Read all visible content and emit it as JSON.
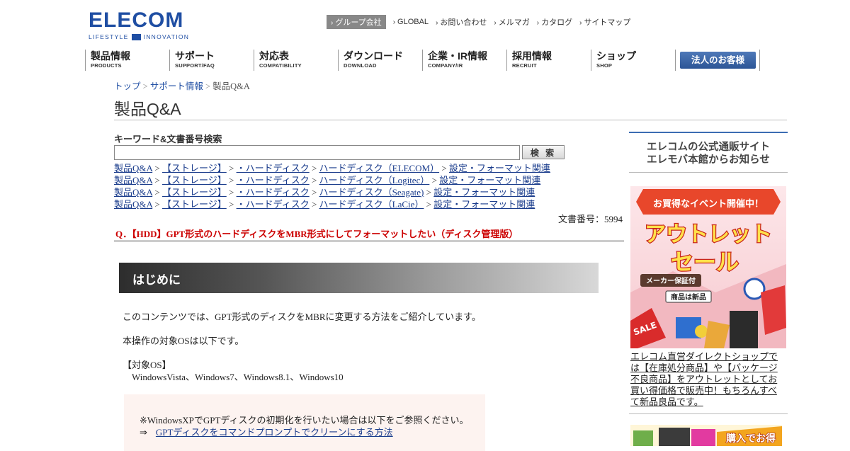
{
  "header": {
    "logo_main": "ELECOM",
    "logo_sub_left": "LIFESTYLE",
    "logo_sub_right": "INNOVATION",
    "util_nav": [
      "グループ会社",
      "GLOBAL",
      "お問い合わせ",
      "メルマガ",
      "カタログ",
      "サイトマップ"
    ],
    "main_nav": [
      {
        "jp": "製品情報",
        "en": "PRODUCTS"
      },
      {
        "jp": "サポート",
        "en": "SUPPORT/FAQ"
      },
      {
        "jp": "対応表",
        "en": "COMPATIBILITY"
      },
      {
        "jp": "ダウンロード",
        "en": "DOWNLOAD"
      },
      {
        "jp": "企業・IR情報",
        "en": "COMPANY/IR"
      },
      {
        "jp": "採用情報",
        "en": "RECRUIT"
      },
      {
        "jp": "ショップ",
        "en": "SHOP"
      }
    ],
    "corporate_button": "法人のお客様"
  },
  "breadcrumb": {
    "top": "トップ",
    "support": "サポート情報",
    "current": "製品Q&A",
    "sep": ">"
  },
  "page_title": "製品Q&A",
  "search": {
    "label": "キーワード&文書番号検索",
    "value": "",
    "button": "検 索"
  },
  "category_paths": [
    [
      "製品Q&A",
      "【ストレージ】",
      "・ハードディスク",
      "ハードディスク（ELECOM）",
      "設定・フォーマット関連"
    ],
    [
      "製品Q&A",
      "【ストレージ】",
      "・ハードディスク",
      "ハードディスク（Logitec）",
      "設定・フォーマット関連"
    ],
    [
      "製品Q&A",
      "【ストレージ】",
      "・ハードディスク",
      "ハードディスク（Seagate)",
      "設定・フォーマット関連"
    ],
    [
      "製品Q&A",
      "【ストレージ】",
      "・ハードディスク",
      "ハードディスク（LaCie）",
      "設定・フォーマット関連"
    ]
  ],
  "doc_number": "文書番号：5994",
  "question": "Q．【HDD】GPT形式のハードディスクをMBR形式にしてフォーマットしたい（ディスク管理版）",
  "article": {
    "intro_heading": "はじめに",
    "p1": "このコンテンツでは、GPT形式のディスクをMBRに変更する方法をご紹介しています。",
    "p2": "本操作の対象OSは以下です。",
    "p3": "【対象OS】",
    "p4": "WindowsVista、Windows7、Windows8.1、Windows10",
    "note": "※WindowsXPでGPTディスクの初期化を行いたい場合は以下をご参照ください。",
    "note_arrow": "⇒",
    "note_link": "GPTディスクをコマンドプロンプトでクリーンにする方法"
  },
  "sidebar": {
    "box_line1": "エレコムの公式通販サイト",
    "box_line2": "エレモバ本館からお知らせ",
    "ad_ribbon": "お買得なイベント開催中！",
    "ad_title1": "アウトレット",
    "ad_title2": "セール",
    "ad_badge": "メーカー保証付",
    "ad_badge2": "商品は新品",
    "ad_sale": "SALE",
    "ad_desc": "エレコム直営ダイレクトショップでは【在庫処分商品】や【パッケージ不良商品】をアウトレットとしてお買い得価格で販売中！もちろんすべて新品良品です。",
    "ad2_text": "購入でお得"
  },
  "colors": {
    "brand": "#1f4ea3",
    "question": "#cc0000",
    "link": "#1a3c8c"
  }
}
